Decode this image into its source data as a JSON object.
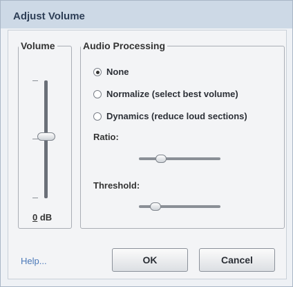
{
  "window": {
    "title": "Adjust Volume"
  },
  "volume": {
    "legend": "Volume",
    "value_number": "0",
    "value_unit": " dB",
    "level": 0.5
  },
  "audio_processing": {
    "legend": "Audio Processing",
    "options": [
      {
        "label": "None",
        "selected": true
      },
      {
        "label": "Normalize (select best volume)",
        "selected": false
      },
      {
        "label": "Dynamics (reduce loud sections)",
        "selected": false
      }
    ],
    "ratio_label": "Ratio:",
    "threshold_label": "Threshold:"
  },
  "footer": {
    "help_label": "Help...",
    "ok_label": "OK",
    "cancel_label": "Cancel"
  },
  "colors": {
    "link": "#4a78b8",
    "title_text": "#2d3e56"
  }
}
